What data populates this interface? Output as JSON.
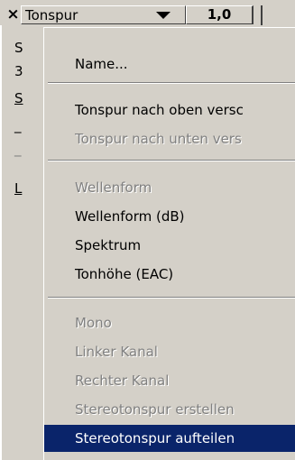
{
  "track_header": {
    "close_label": "×",
    "track_name": "Tonspur",
    "rate_value": "1,0",
    "left_strip": [
      "S",
      "3",
      "S",
      "_",
      "_",
      "L"
    ]
  },
  "menu": {
    "items": [
      {
        "label": "Name...",
        "enabled": true,
        "selected": false
      },
      {
        "label": "Tonspur nach oben versc",
        "enabled": true,
        "selected": false
      },
      {
        "label": "Tonspur nach unten vers",
        "enabled": false,
        "selected": false
      },
      {
        "label": "Wellenform",
        "enabled": false,
        "selected": false
      },
      {
        "label": "Wellenform (dB)",
        "enabled": true,
        "selected": false
      },
      {
        "label": "Spektrum",
        "enabled": true,
        "selected": false
      },
      {
        "label": "Tonhöhe (EAC)",
        "enabled": true,
        "selected": false
      },
      {
        "label": "Mono",
        "enabled": false,
        "selected": false
      },
      {
        "label": "Linker Kanal",
        "enabled": false,
        "selected": false
      },
      {
        "label": "Rechter Kanal",
        "enabled": false,
        "selected": false
      },
      {
        "label": "Stereotonspur erstellen",
        "enabled": false,
        "selected": false
      },
      {
        "label": "Stereotonspur aufteilen",
        "enabled": true,
        "selected": true
      }
    ]
  },
  "colors": {
    "background": "#d4d0c8",
    "selection": "#0a246a",
    "disabled_text": "#808080"
  }
}
